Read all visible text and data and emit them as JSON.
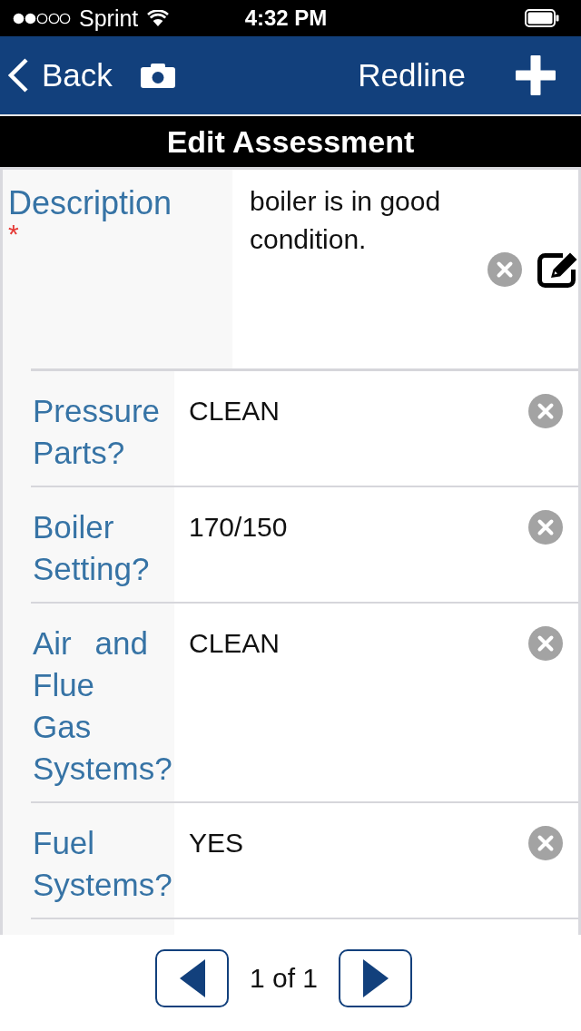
{
  "status_bar": {
    "carrier": "Sprint",
    "time": "4:32 PM"
  },
  "nav_bar": {
    "back": "Back",
    "action": "Redline"
  },
  "header": {
    "title": "Edit Assessment"
  },
  "description": {
    "label": "Description",
    "required_mark": "*",
    "value": "boiler is in good condition."
  },
  "fields": [
    {
      "label": "Pressure Parts?",
      "value": "CLEAN"
    },
    {
      "label": "Boiler Setting?",
      "value": "170/150"
    },
    {
      "label": "Air and Flue Gas Systems?",
      "value": "CLEAN"
    },
    {
      "label": "Fuel Systems?",
      "value": "YES"
    }
  ],
  "pagination": {
    "text": "1 of 1"
  }
}
